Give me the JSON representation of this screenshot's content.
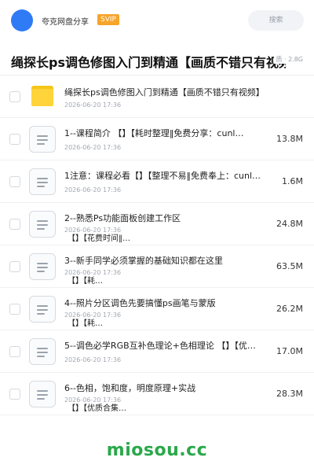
{
  "header": {
    "username": "夸克网盘分享",
    "badge": "SVIP",
    "search_placeholder": "搜索"
  },
  "folder": {
    "title": "绳探长ps调色修图入门到精通【画质不错只有视频】",
    "meta": "质 · 2.8G"
  },
  "items": [
    {
      "type": "folder",
      "name": "绳探长ps调色修图入门到精通【画质不错只有视频】",
      "date": "2026-06-20 17:36",
      "size": ""
    },
    {
      "type": "file",
      "name": "1--课程简介 【】【耗时整理‖免费分享：cunl…",
      "date": "2026-06-20 17:36",
      "size": "13.8M"
    },
    {
      "type": "file",
      "name": "1注意：课程必看【】【整理不易‖免费奉上：cunl…",
      "date": "2026-06-20 17:36",
      "size": "1.6M"
    },
    {
      "type": "file",
      "name": "2--熟悉Ps功能面板创建工作区",
      "sub": "【】【花费时间‖…",
      "date": "2026-06-20 17:36",
      "size": "24.8M"
    },
    {
      "type": "file",
      "name": "3--新手同学必须掌握的基础知识都在这里",
      "sub": "【】【耗…",
      "date": "2026-06-20 17:36",
      "size": "63.5M"
    },
    {
      "type": "file",
      "name": "4--照片分区调色先要搞懂ps画笔与蒙版",
      "sub": "【】【耗…",
      "date": "2026-06-20 17:36",
      "size": "26.2M"
    },
    {
      "type": "file",
      "name": "5--调色必学RGB互补色理论+色相理论 【】【优…",
      "date": "2026-06-20 17:36",
      "size": "17.0M"
    },
    {
      "type": "file",
      "name": "6--色相，饱和度，明度原理+实战",
      "sub": "【】【优质合集…",
      "date": "2026-06-20 17:36",
      "size": "28.3M"
    }
  ],
  "watermark": "miosou.cc",
  "colors": {
    "accent": "#2f7bf5",
    "svip": "#f6a42a",
    "folder": "#ffd43b",
    "watermark": "#2aa84a"
  }
}
